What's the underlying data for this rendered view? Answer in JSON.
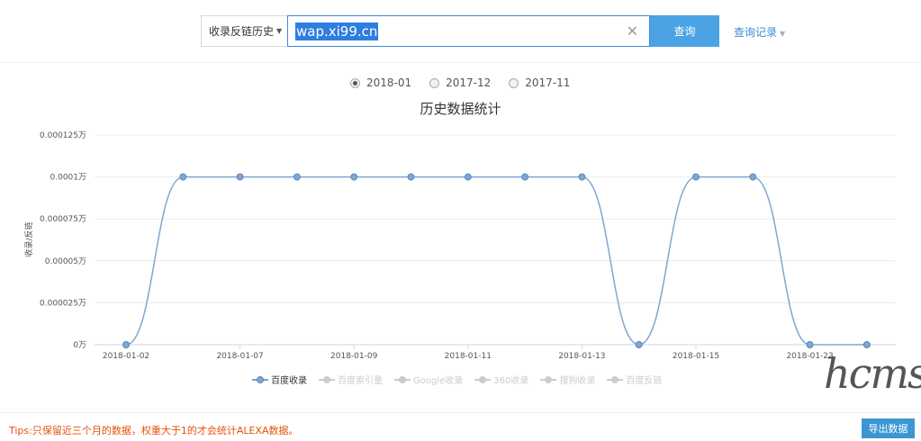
{
  "search": {
    "select_label": "收录反链历史",
    "value": "wap.xi99.cn",
    "query_button": "查询",
    "history_label": "查询记录"
  },
  "months": [
    {
      "label": "2018-01",
      "selected": true
    },
    {
      "label": "2017-12",
      "selected": false
    },
    {
      "label": "2017-11",
      "selected": false
    }
  ],
  "legend": [
    {
      "label": "百度收录",
      "active": true
    },
    {
      "label": "百度索引量",
      "active": false
    },
    {
      "label": "Google收录",
      "active": false
    },
    {
      "label": "360收录",
      "active": false
    },
    {
      "label": "搜狗收录",
      "active": false
    },
    {
      "label": "百度反链",
      "active": false
    }
  ],
  "tips": "Tips:只保留近三个月的数据，权重大于1的才会统计ALEXA数据。",
  "export_button": "导出数据",
  "watermark": "hcms",
  "chart_data": {
    "type": "line",
    "title": "历史数据统计",
    "ylabel": "收录/反链",
    "xlabel": "",
    "y_ticks": [
      "0万",
      "0.000025万",
      "0.00005万",
      "0.000075万",
      "0.0001万",
      "0.000125万"
    ],
    "ylim": [
      0,
      0.000125
    ],
    "x_tick_labels": [
      "2018-01-02",
      "2018-01-07",
      "2018-01-09",
      "2018-01-11",
      "2018-01-13",
      "2018-01-15",
      "2018-01-23"
    ],
    "series": [
      {
        "name": "百度收录",
        "color": "#7ea7d3",
        "values": [
          0,
          0.0001,
          0.0001,
          0.0001,
          0.0001,
          0.0001,
          0.0001,
          0.0001,
          0.0001,
          0,
          0.0001,
          0.0001,
          0,
          0
        ]
      }
    ],
    "grid": true,
    "legend_position": "bottom"
  }
}
